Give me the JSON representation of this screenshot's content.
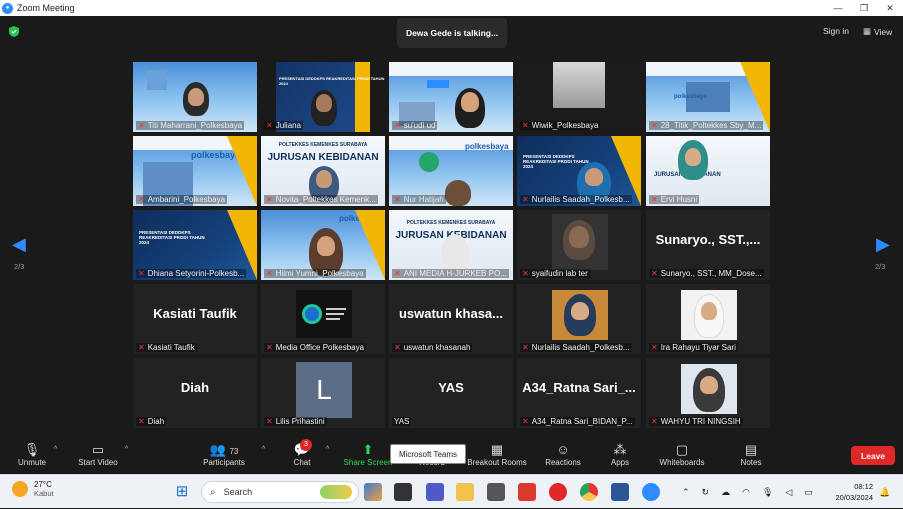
{
  "window": {
    "title": "Zoom Meeting"
  },
  "meeting": {
    "talking_toast": "Dewa Gede is talking...",
    "sign_in": "Sign in",
    "view": "View",
    "page_indicator": "2/3"
  },
  "tiles": [
    "Titi Maharrani_Polkesbaya",
    "Juliana",
    "su'udi ud",
    "Wiwik_Polkesbaya",
    "28_Titik_Poltekkes Sby_M...",
    "Ambarini_Polkesbaya",
    "Novita_Poltekkes Kemenk...",
    "Nur Hatijah",
    "Nurlailis Saadah_Polkesb...",
    "Ervi Husni",
    "Dhiana Setyorini-Polkesb...",
    "Hilmi Yumni_Polkesbaya",
    "ANI MEDIA H-JURKEB PO...",
    "syaifudin lab ter",
    "Sunaryo., SST., MM_Dose...",
    "Kasiati Taufik",
    "Media Office Polkesbaya",
    "uswatun khasanah",
    "Nurlailis Saadah_Polkesb...",
    "Ira Rahayu Tiyar Sari",
    "Diah",
    "Lilis Prihastini",
    "YAS",
    "A34_Ratna Sari_BIDAN_P...",
    "WAHYU TRI NINGSIH"
  ],
  "big_names": {
    "sunaryo": "Sunaryo., SST.,...",
    "kasiati": "Kasiati Taufik",
    "uswatun": "uswatun  khasa...",
    "diah": "Diah",
    "yas": "YAS",
    "ratna": "A34_Ratna  Sari_...",
    "lilis_initial": "L"
  },
  "slides": {
    "polkesbaya": "polkesbaya",
    "jurusan": "JURUSAN KEBIDANAN",
    "poltekkes": "POLTEKKES KEMENKES SURABAYA",
    "presentasi": "PRESENTASI DEDDKPS REAKREDITASI PRODI TAHUN 2024"
  },
  "toolbar": {
    "unmute": "Unmute",
    "start_video": "Start Video",
    "participants": "Participants",
    "participants_count": "73",
    "chat": "Chat",
    "chat_badge": "3",
    "share_screen": "Share Screen",
    "record": "Record",
    "breakout": "Breakout Rooms",
    "reactions": "Reactions",
    "apps": "Apps",
    "whiteboards": "Whiteboards",
    "notes": "Notes",
    "leave": "Leave",
    "tooltip": "Microsoft Teams"
  },
  "taskbar": {
    "temp": "27°C",
    "weather": "Kabut",
    "search": "Search",
    "time": "08:12",
    "date": "20/03/2024"
  },
  "colors": {
    "accent": "#2d8cff",
    "leave": "#e02828",
    "share": "#23d959",
    "muted": "#e33333"
  }
}
